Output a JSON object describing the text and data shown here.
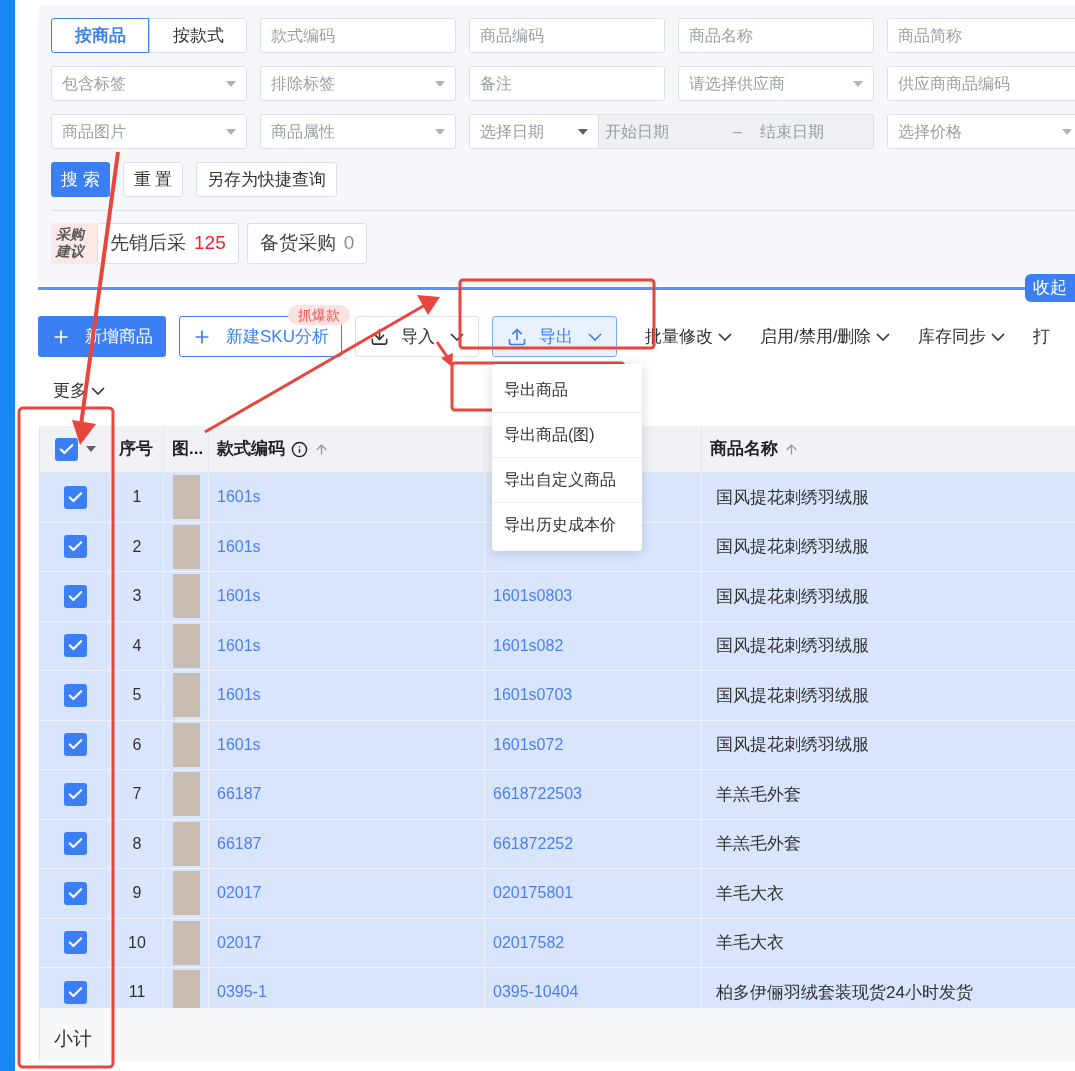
{
  "filter": {
    "mode_toggle": [
      {
        "label": "按商品",
        "selected": true
      },
      {
        "label": "按款式",
        "selected": false
      }
    ],
    "fields": [
      {
        "kind": "input",
        "placeholder": "款式编码"
      },
      {
        "kind": "input",
        "placeholder": "商品编码"
      },
      {
        "kind": "input",
        "placeholder": "商品名称"
      },
      {
        "kind": "input",
        "placeholder": "商品简称"
      },
      {
        "kind": "select",
        "placeholder": "包含标签"
      },
      {
        "kind": "select",
        "placeholder": "排除标签"
      },
      {
        "kind": "input",
        "placeholder": "备注"
      },
      {
        "kind": "select",
        "placeholder": "请选择供应商"
      },
      {
        "kind": "input",
        "placeholder": "供应商商品编码"
      },
      {
        "kind": "select",
        "placeholder": "商品图片"
      },
      {
        "kind": "select",
        "placeholder": "商品属性"
      },
      {
        "kind": "daterange",
        "placeholder": "选择日期",
        "start_placeholder": "开始日期",
        "separator": "–",
        "end_placeholder": "结束日期"
      },
      {
        "kind": "select",
        "placeholder": "选择价格"
      }
    ],
    "buttons": [
      {
        "kind": "primary",
        "label": "搜 索"
      },
      {
        "kind": "default",
        "label": "重 置"
      },
      {
        "kind": "default",
        "label": "另存为快捷查询"
      }
    ],
    "purchase_badge": "采购建议",
    "purchase_tabs": [
      {
        "label": "先销后采",
        "count": "125",
        "color": "#f5222d"
      },
      {
        "label": "备货采购",
        "count": "0",
        "color": "#8c8c8c"
      }
    ],
    "collapse": "收起"
  },
  "toolbar": [
    {
      "kind": "primary",
      "label": "新增商品"
    },
    {
      "kind": "outline",
      "label": "新建SKU分析",
      "badge": "抓爆款"
    },
    {
      "kind": "import",
      "label": "导入"
    },
    {
      "kind": "export",
      "label": "导出",
      "expanded": true,
      "menu_items": [
        "导出商品",
        "导出商品(图)",
        "导出自定义商品",
        "导出历史成本价"
      ]
    },
    {
      "kind": "menu",
      "label": "批量修改"
    },
    {
      "kind": "menu",
      "label": "启用/禁用/删除"
    },
    {
      "kind": "menu",
      "label": "库存同步"
    },
    {
      "kind": "label",
      "label": "打"
    }
  ],
  "more": "更多",
  "table": {
    "select_all_checked": true,
    "columns": [
      {
        "label": "序号"
      },
      {
        "label": "图..."
      },
      {
        "label": "款式编码",
        "sortable": true,
        "info": true
      },
      {
        "label": "商品名称",
        "sortable": true,
        "info": false
      }
    ],
    "rows": [
      {
        "checked": true,
        "no": "1",
        "style_code": "1601s",
        "name": "国风提花刺绣羽绒服"
      },
      {
        "checked": true,
        "no": "2",
        "style_code": "1601s",
        "name": "国风提花刺绣羽绒服"
      },
      {
        "checked": true,
        "no": "3",
        "style_code": "1601s",
        "product_code": "1601s0803",
        "name": "国风提花刺绣羽绒服"
      },
      {
        "checked": true,
        "no": "4",
        "style_code": "1601s",
        "product_code": "1601s082",
        "name": "国风提花刺绣羽绒服"
      },
      {
        "checked": true,
        "no": "5",
        "style_code": "1601s",
        "product_code": "1601s0703",
        "name": "国风提花刺绣羽绒服"
      },
      {
        "checked": true,
        "no": "6",
        "style_code": "1601s",
        "product_code": "1601s072",
        "name": "国风提花刺绣羽绒服"
      },
      {
        "checked": true,
        "no": "7",
        "style_code": "66187",
        "product_code": "6618722503",
        "name": "羊羔毛外套"
      },
      {
        "checked": true,
        "no": "8",
        "style_code": "66187",
        "product_code": "661872252",
        "name": "羊羔毛外套"
      },
      {
        "checked": true,
        "no": "9",
        "style_code": "02017",
        "product_code": "020175801",
        "name": "羊毛大衣"
      },
      {
        "checked": true,
        "no": "10",
        "style_code": "02017",
        "product_code": "02017582",
        "name": "羊毛大衣"
      },
      {
        "checked": true,
        "no": "11",
        "style_code": "0395-1",
        "product_code": "0395-10404",
        "name": "柏多伊俪羽绒套装现货24小时发货"
      }
    ],
    "footer": "小计"
  }
}
